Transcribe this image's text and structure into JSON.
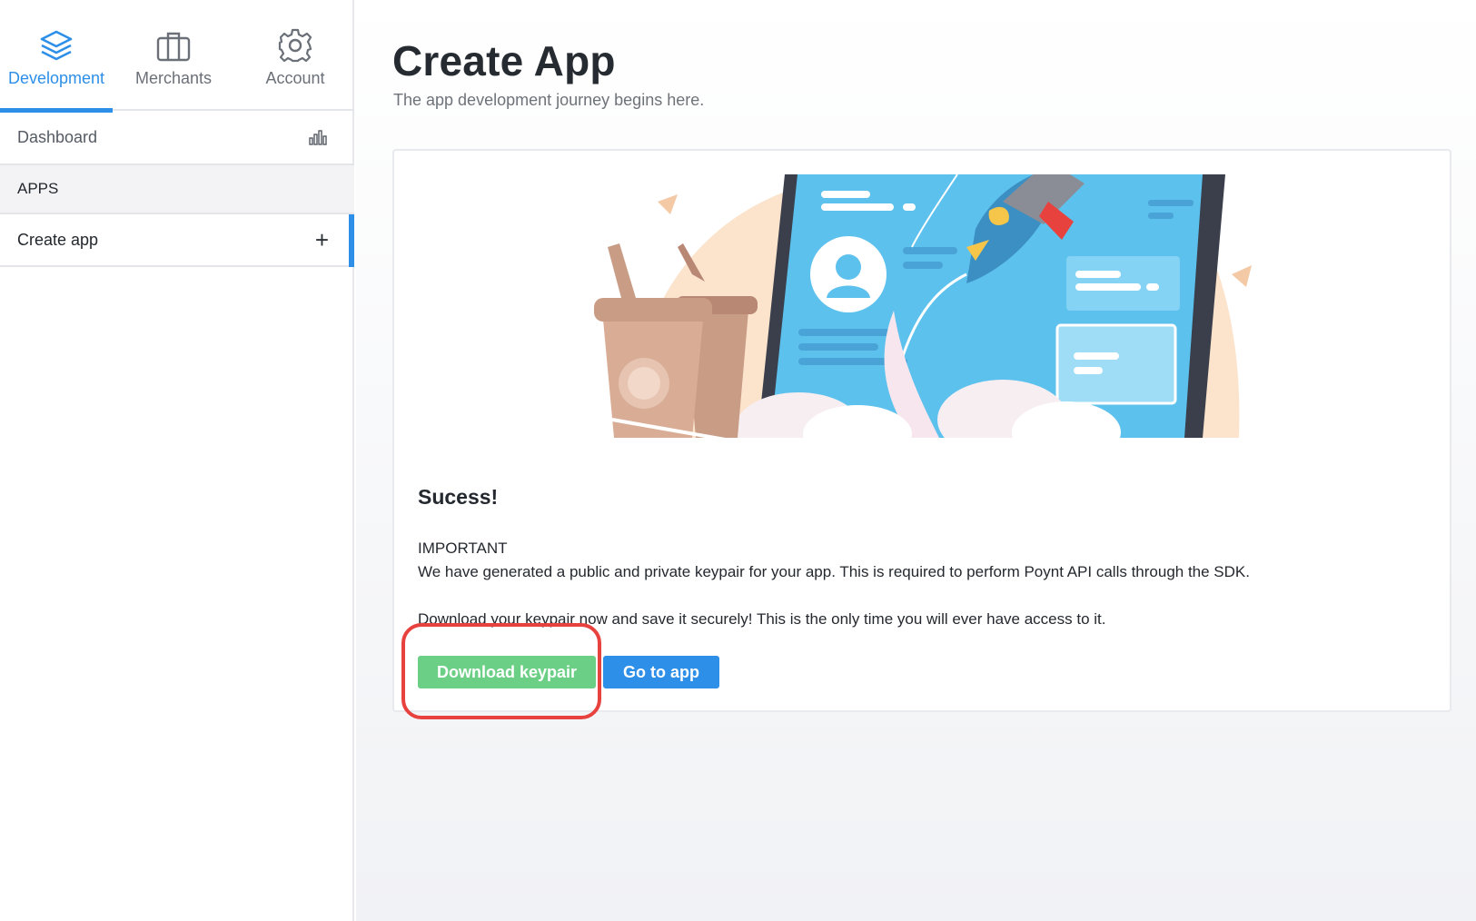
{
  "sidebar": {
    "tabs": [
      {
        "label": "Development",
        "icon": "layers-icon",
        "active": true
      },
      {
        "label": "Merchants",
        "icon": "briefcase-icon",
        "active": false
      },
      {
        "label": "Account",
        "icon": "gear-icon",
        "active": false
      }
    ],
    "dashboard_label": "Dashboard",
    "section_label": "APPS",
    "create_app_label": "Create app"
  },
  "main": {
    "title": "Create App",
    "subtitle": "The app development journey begins here.",
    "card": {
      "heading": "Sucess!",
      "important_label": "IMPORTANT",
      "message_1": "We have generated a public and private keypair for your app. This is required to perform Poynt API calls through the SDK.",
      "message_2": "Download your keypair now and save it securely! This is the only time you will ever have access to it.",
      "download_button": "Download keypair",
      "go_to_app_button": "Go to app"
    }
  },
  "colors": {
    "accent": "#2d8fe8",
    "success_button": "#6ccf86",
    "annotation": "#e8423f"
  }
}
